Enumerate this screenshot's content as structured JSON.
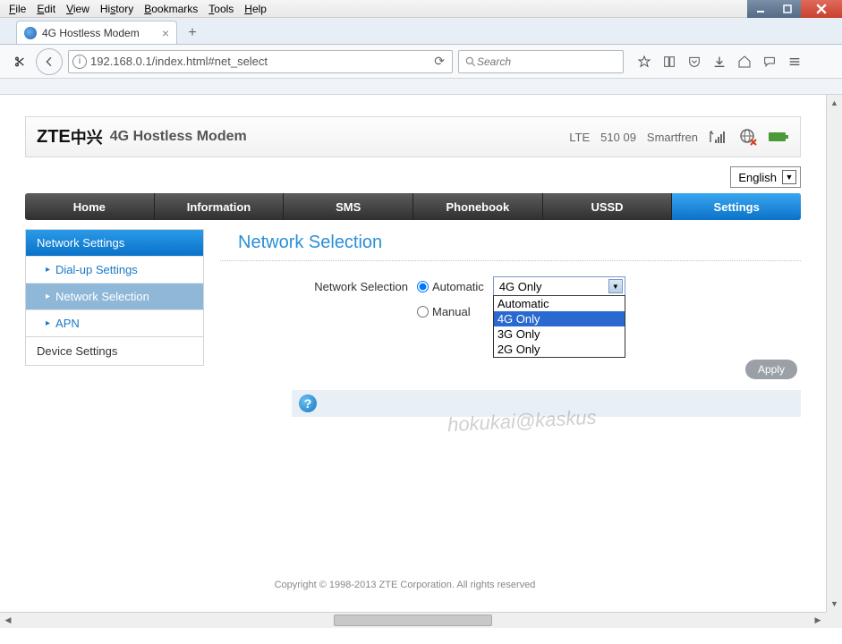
{
  "menubar": [
    "File",
    "Edit",
    "View",
    "History",
    "Bookmarks",
    "Tools",
    "Help"
  ],
  "tab": {
    "title": "4G Hostless Modem"
  },
  "url": "192.168.0.1/index.html#net_select",
  "search_placeholder": "Search",
  "router": {
    "logo_latin": "ZTE",
    "logo_cjk": "中兴",
    "product": "4G Hostless Modem",
    "status": {
      "tech": "LTE",
      "code": "510 09",
      "operator": "Smartfren"
    },
    "language": "English"
  },
  "nav": [
    "Home",
    "Information",
    "SMS",
    "Phonebook",
    "USSD",
    "Settings"
  ],
  "nav_active": 5,
  "sidebar": {
    "group_head": "Network Settings",
    "items": [
      {
        "label": "Dial-up Settings",
        "selected": false
      },
      {
        "label": "Network Selection",
        "selected": true
      },
      {
        "label": "APN",
        "selected": false
      }
    ],
    "plain": "Device Settings"
  },
  "content": {
    "title": "Network Selection",
    "field_label": "Network Selection",
    "radio_auto": "Automatic",
    "radio_manual": "Manual",
    "selected_radio": "auto",
    "combo_value": "4G Only",
    "combo_options": [
      "Automatic",
      "4G Only",
      "3G Only",
      "2G Only"
    ],
    "combo_selected_index": 1,
    "apply": "Apply"
  },
  "watermark": "hokukai@kaskus",
  "footer": "Copyright © 1998-2013 ZTE Corporation. All rights reserved"
}
